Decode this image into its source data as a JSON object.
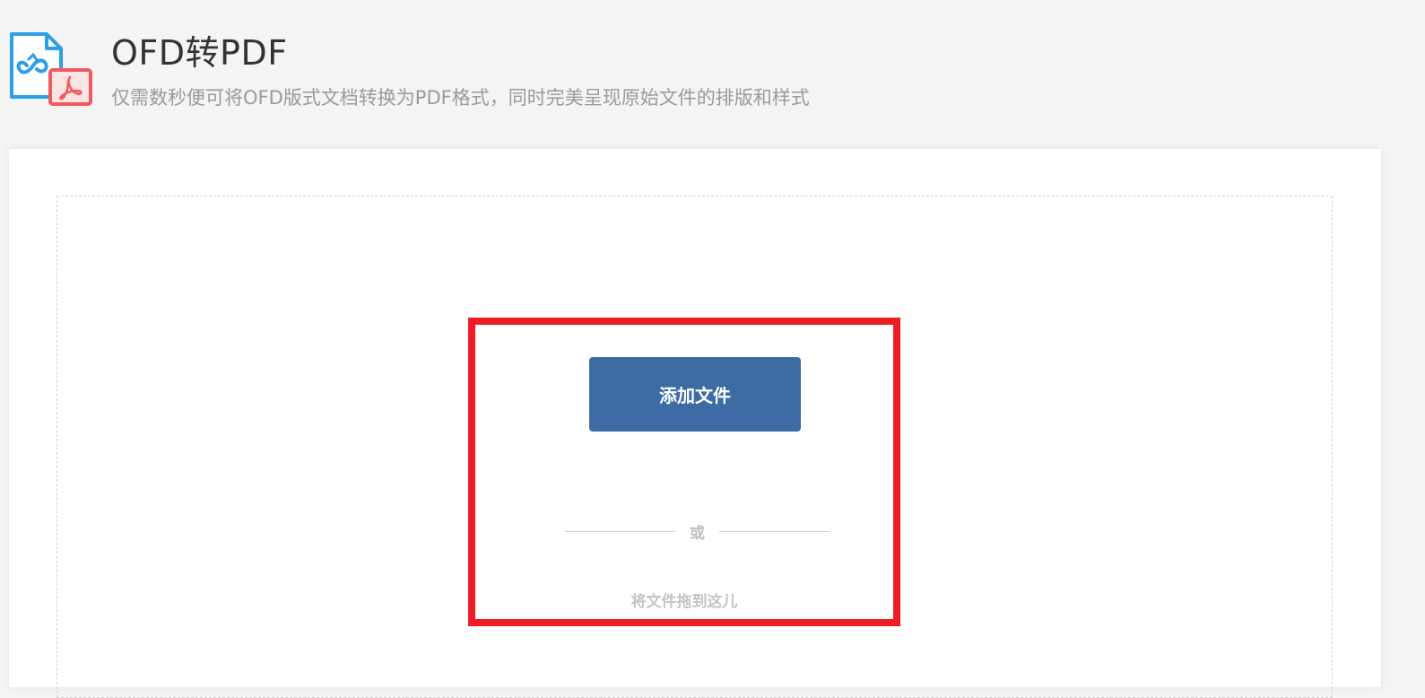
{
  "header": {
    "title": "OFD转PDF",
    "subtitle": "仅需数秒便可将OFD版式文档转换为PDF格式，同时完美呈现原始文件的排版和样式",
    "icon": "ofd-to-pdf-icon"
  },
  "upload": {
    "add_button_label": "添加文件",
    "divider_text": "或",
    "drag_hint": "将文件拖到这儿"
  },
  "colors": {
    "background": "#f4f4f4",
    "card": "#ffffff",
    "button": "#3d6ca5",
    "highlight": "#ee1c25",
    "ofd_blue": "#2d9fe6",
    "pdf_red": "#ef5a5f"
  }
}
